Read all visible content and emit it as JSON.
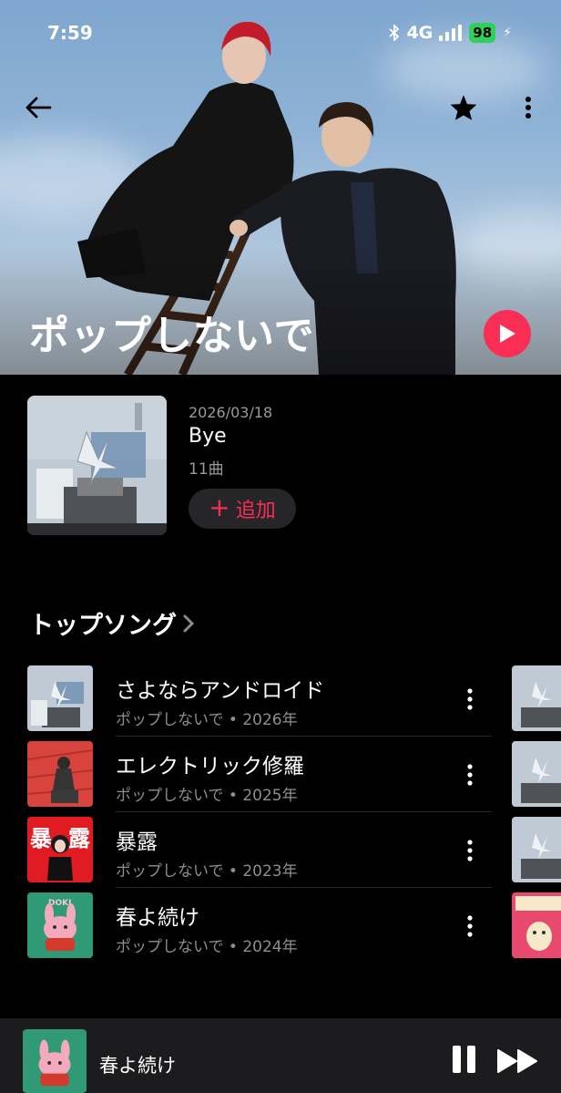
{
  "status_bar": {
    "time": "7:59",
    "network": "4G",
    "battery": "98"
  },
  "hero": {
    "artist_name": "ポップしないで",
    "icons": {
      "back": "arrow-left-icon",
      "favorite": "star-icon",
      "more": "more-vertical-icon",
      "play": "play-icon"
    }
  },
  "latest_release": {
    "date": "2026/03/18",
    "title": "Bye",
    "track_count": "11曲",
    "add_label": "追加",
    "add_icon": "plus-icon"
  },
  "top_songs": {
    "heading": "トップソング",
    "items": [
      {
        "title": "さよならアンドロイド",
        "subtitle": "ポップしないで • 2026年"
      },
      {
        "title": "エレクトリック修羅",
        "subtitle": "ポップしないで • 2025年"
      },
      {
        "title": "暴露",
        "subtitle": "ポップしないで • 2023年",
        "art_text": [
          "暴",
          "露"
        ]
      },
      {
        "title": "春よ続け",
        "subtitle": "ポップしないで • 2024年",
        "art_text": "DOKI"
      }
    ]
  },
  "mini_player": {
    "title": "春よ続け"
  },
  "colors": {
    "accent": "#fa2d55",
    "background": "#000000",
    "secondary_text": "#8e8e8e",
    "battery": "#30d158"
  }
}
